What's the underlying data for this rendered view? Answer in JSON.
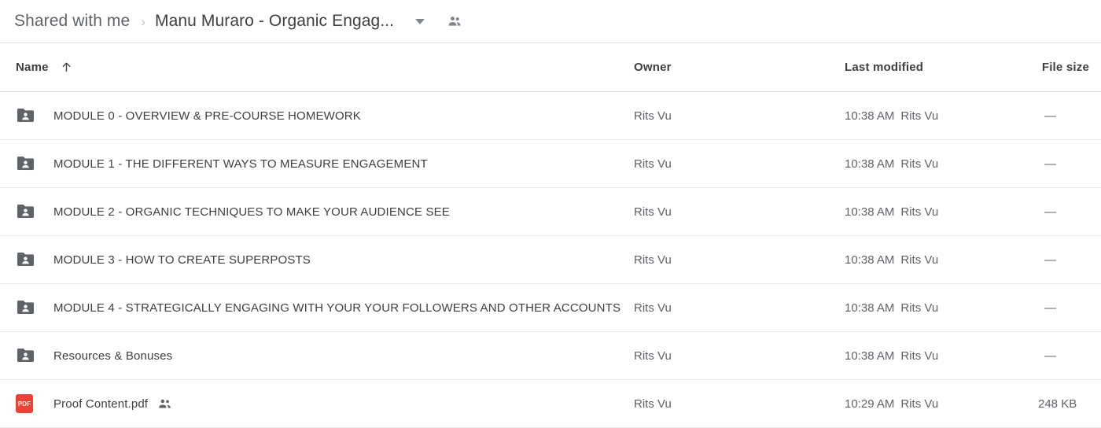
{
  "breadcrumb": {
    "root_label": "Shared with me",
    "separator": "›",
    "current_label": "Manu Muraro - Organic Engag...",
    "caret_icon": "chevron-down-icon",
    "people_icon": "people-icon"
  },
  "columns": {
    "name": "Name",
    "owner": "Owner",
    "last_modified": "Last modified",
    "file_size": "File size",
    "sort_icon": "arrow-up-icon",
    "sort_direction": "ascending"
  },
  "rows": [
    {
      "icon": "shared-folder-icon",
      "type": "folder",
      "name": "MODULE 0 - OVERVIEW & PRE-COURSE HOMEWORK",
      "owner": "Rits Vu",
      "modified_time": "10:38 AM",
      "modified_by": "Rits Vu",
      "size": "—",
      "shared": false
    },
    {
      "icon": "shared-folder-icon",
      "type": "folder",
      "name": "MODULE 1 - THE DIFFERENT WAYS TO MEASURE ENGAGEMENT",
      "owner": "Rits Vu",
      "modified_time": "10:38 AM",
      "modified_by": "Rits Vu",
      "size": "—",
      "shared": false
    },
    {
      "icon": "shared-folder-icon",
      "type": "folder",
      "name": "MODULE 2 - ORGANIC TECHNIQUES TO MAKE YOUR AUDIENCE SEE",
      "owner": "Rits Vu",
      "modified_time": "10:38 AM",
      "modified_by": "Rits Vu",
      "size": "—",
      "shared": false
    },
    {
      "icon": "shared-folder-icon",
      "type": "folder",
      "name": "MODULE 3 - HOW TO CREATE SUPERPOSTS",
      "owner": "Rits Vu",
      "modified_time": "10:38 AM",
      "modified_by": "Rits Vu",
      "size": "—",
      "shared": false
    },
    {
      "icon": "shared-folder-icon",
      "type": "folder",
      "name": "MODULE 4 - STRATEGICALLY ENGAGING WITH YOUR YOUR FOLLOWERS AND OTHER ACCOUNTS",
      "owner": "Rits Vu",
      "modified_time": "10:38 AM",
      "modified_by": "Rits Vu",
      "size": "—",
      "shared": false
    },
    {
      "icon": "shared-folder-icon",
      "type": "folder",
      "name": "Resources & Bonuses",
      "owner": "Rits Vu",
      "modified_time": "10:38 AM",
      "modified_by": "Rits Vu",
      "size": "—",
      "shared": false
    },
    {
      "icon": "pdf-file-icon",
      "type": "pdf",
      "icon_label": "PDF",
      "name": "Proof Content.pdf",
      "owner": "Rits Vu",
      "modified_time": "10:29 AM",
      "modified_by": "Rits Vu",
      "size": "248 KB",
      "shared": true
    }
  ],
  "colors": {
    "pdf_red": "#ea4335",
    "folder_gray": "#5f6368",
    "text_primary": "#3c4043",
    "text_secondary": "#5f6368",
    "divider": "#e8eaed"
  }
}
